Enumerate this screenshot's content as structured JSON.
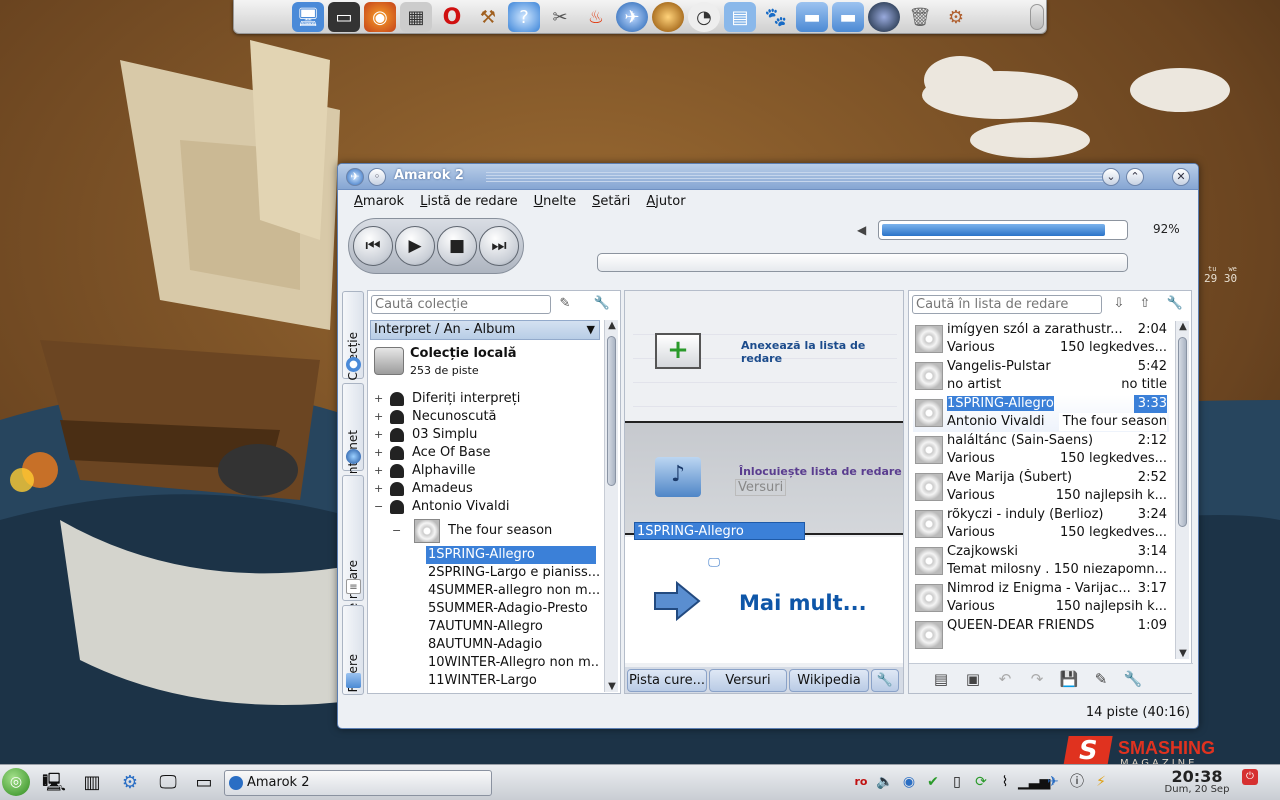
{
  "window": {
    "title": "Amarok 2"
  },
  "menu": [
    "Amarok",
    "Listă de redare",
    "Unelte",
    "Setări",
    "Ajutor"
  ],
  "player": {
    "volume_percent": 92,
    "volume_label": "92%"
  },
  "sidetabs": [
    "Colecție",
    "Internet",
    "Liste de redare",
    "Fișiere"
  ],
  "collection": {
    "search_placeholder": "Caută colecție",
    "sort": "Interpret / An - Album",
    "title": "Colecție locală",
    "count": "253 de piste",
    "artists": [
      "Diferiți interpreți",
      "Necunoscută",
      "03 Simplu",
      "Ace Of Base",
      "Alphaville",
      "Amadeus",
      "Antonio Vivaldi"
    ],
    "album": "The four season",
    "tracks": [
      "1SPRING-Allegro",
      "2SPRING-Largo e pianiss...",
      "4SUMMER-allegro non m...",
      "5SUMMER-Adagio-Presto",
      "7AUTUMN-Allegro",
      "8AUTUMN-Adagio",
      "10WINTER-Allegro non m...",
      "11WINTER-Largo"
    ]
  },
  "context": {
    "append": "Anexează la lista de redare",
    "replace": "Înlocuiește lista de redare",
    "ghost_label": "Versuri",
    "drag_item": "1SPRING-Allegro",
    "more": "Mai mult...",
    "tabs": [
      "Pista cure...",
      "Versuri",
      "Wikipedia"
    ]
  },
  "playlist": {
    "search_placeholder": "Caută în lista de redare",
    "items": [
      {
        "title": "imígyen szól a  zarathustr...",
        "time": "2:04",
        "artist": "Various",
        "album": "150 legkedves..."
      },
      {
        "title": "Vangelis-Pulstar",
        "time": "5:42",
        "artist": "no artist",
        "album": "no title"
      },
      {
        "title": "1SPRING-Allegro",
        "time": "3:33",
        "artist": "Antonio Vivaldi",
        "album": "The four season"
      },
      {
        "title": "haláltánc (Sain-Saens)",
        "time": "2:12",
        "artist": "Various",
        "album": "150 legkedves..."
      },
      {
        "title": "Ave Marija (Šubert)",
        "time": "2:52",
        "artist": "Various",
        "album": "150 najlepsih k..."
      },
      {
        "title": "rõkyczi - induly (Berlioz)",
        "time": "3:24",
        "artist": "Various",
        "album": "150 legkedves..."
      },
      {
        "title": "Czajkowski",
        "time": "3:14",
        "artist": "Temat milosny ...",
        "album": "150 niezapomn..."
      },
      {
        "title": "Nimrod iz Enigma - Varijac...",
        "time": "3:17",
        "artist": "Various",
        "album": "150 najlepsih k..."
      },
      {
        "title": "QUEEN-DEAR FRIENDS",
        "time": "1:09",
        "artist": "",
        "album": ""
      }
    ],
    "status": "14 piste (40:16)"
  },
  "desktop": {
    "cal_days": [
      "tu",
      "we"
    ],
    "cal_dates": "29 30",
    "task": "Amarok 2",
    "clock_time": "20:38",
    "clock_date": "Dum, 20 Sep",
    "brand": "SMASHING",
    "brand_sub": "MAGAZINE",
    "brand_letter": "S"
  }
}
